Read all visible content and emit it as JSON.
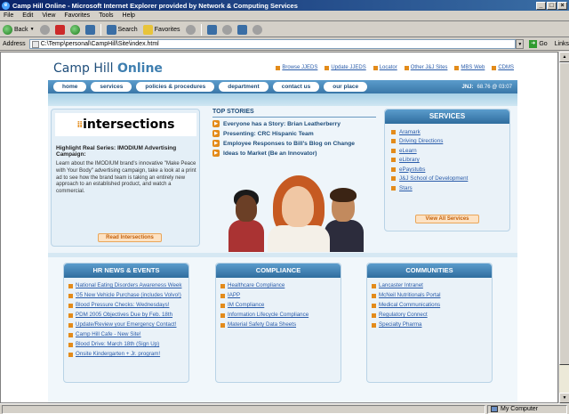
{
  "window": {
    "title": "Camp Hill Online - Microsoft Internet Explorer provided by Network & Computing Services",
    "buttons": [
      "_",
      "□",
      "×"
    ]
  },
  "menu": [
    "File",
    "Edit",
    "View",
    "Favorites",
    "Tools",
    "Help"
  ],
  "toolbar": {
    "back": "Back",
    "search": "Search",
    "favorites": "Favorites"
  },
  "address": {
    "label": "Address",
    "url": "C:\\Temp\\personal\\CampHill\\Site\\index.html",
    "go": "Go",
    "links": "Links"
  },
  "status": {
    "text": "",
    "zone": "My Computer"
  },
  "site": {
    "logo_a": "Camp Hill ",
    "logo_b": "Online",
    "toplinks": [
      "Browse JJEDS",
      "Update JJEDS",
      "Locator",
      "Other J&J Sites",
      "MBS Web",
      "CDMS"
    ],
    "nav": [
      "home",
      "services",
      "policies & procedures",
      "department",
      "contact us",
      "our place"
    ],
    "ticker_label": "JNJ:",
    "ticker_value": "68.76 @ 03:07"
  },
  "promo": {
    "logo": "intersections",
    "heading": "Highlight Real Series: IMODIUM Advertising Campaign:",
    "body": "Learn about the IMODIUM brand's innovative \"Make Peace with Your Body\" advertising campaign, take a look at a print ad to see how the brand team is taking an entirely new approach to an established product, and watch a commercial.",
    "button": "Read Intersections"
  },
  "top_stories": {
    "title": "TOP STORIES",
    "items": [
      "Everyone has a Story: Brian Leatherberry",
      "Presenting: CRC Hispanic Team",
      "Employee Responses to Bill's Blog on Change",
      "Ideas to Market (Be an Innovator)"
    ]
  },
  "services": {
    "title": "SERVICES",
    "items": [
      "Aramark",
      "Driving Directions",
      "eLearn",
      "eLibrary",
      "ePaystubs",
      "J&J School of Development",
      "Stars"
    ],
    "button": "View All Services"
  },
  "hr_news": {
    "title": "HR NEWS & EVENTS",
    "items": [
      "National Eating Disorders Awareness Week",
      "'05 New Vehicle Purchase (includes Volvo!)",
      "Blood Pressure Checks: Wednesdays!",
      "PDM 2005 Objectives Due by Feb. 18th",
      "Update/Review your Emergency Contact!",
      "Camp Hill Cafe - New Site!",
      "Blood Drive: March 18th (Sign Up)",
      "Onsite Kindergarten + Jr. program!"
    ]
  },
  "compliance": {
    "title": "COMPLIANCE",
    "items": [
      "Healthcare Compliance",
      "IAPP",
      "IM Compliance",
      "Information Lifecycle Compliance",
      "Material Safety Data Sheets"
    ]
  },
  "communities": {
    "title": "COMMUNITIES",
    "items": [
      "Lancaster Intranet",
      "McNeil Nutritionals Portal",
      "Medical Communications",
      "Regulatory Connect",
      "Specialty Pharma"
    ]
  }
}
